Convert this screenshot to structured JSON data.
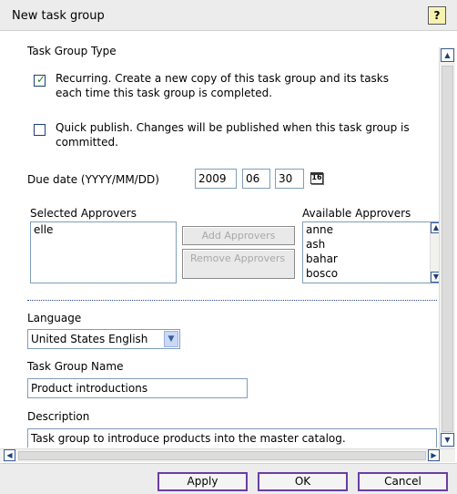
{
  "dialog": {
    "title": "New task group",
    "help_label": "?"
  },
  "form": {
    "task_group_type_label": "Task Group Type",
    "recurring": {
      "checked": true,
      "line1": "Recurring. Create a new copy of this task group and its tasks",
      "line2": "each time this task group is completed."
    },
    "quick_publish": {
      "checked": false,
      "line1": "Quick publish. Changes will be published when this task group is",
      "line2": "committed."
    },
    "due_date": {
      "label": "Due date (YYYY/MM/DD)",
      "year": "2009",
      "month": "06",
      "day": "30",
      "calendar_icon_text": "16"
    },
    "approvers": {
      "selected_label": "Selected Approvers",
      "available_label": "Available Approvers",
      "selected": [
        "elle"
      ],
      "available": [
        "anne",
        "ash",
        "bahar",
        "bosco"
      ],
      "add_label": "Add Approvers",
      "remove_label": "Remove Approvers"
    },
    "language": {
      "label": "Language",
      "value": "United States English"
    },
    "task_group_name": {
      "label": "Task Group Name",
      "value": "Product introductions"
    },
    "description": {
      "label": "Description",
      "value": "Task group to introduce products into the master catalog."
    }
  },
  "footer": {
    "apply_label": "Apply",
    "ok_label": "OK",
    "cancel_label": "Cancel"
  }
}
